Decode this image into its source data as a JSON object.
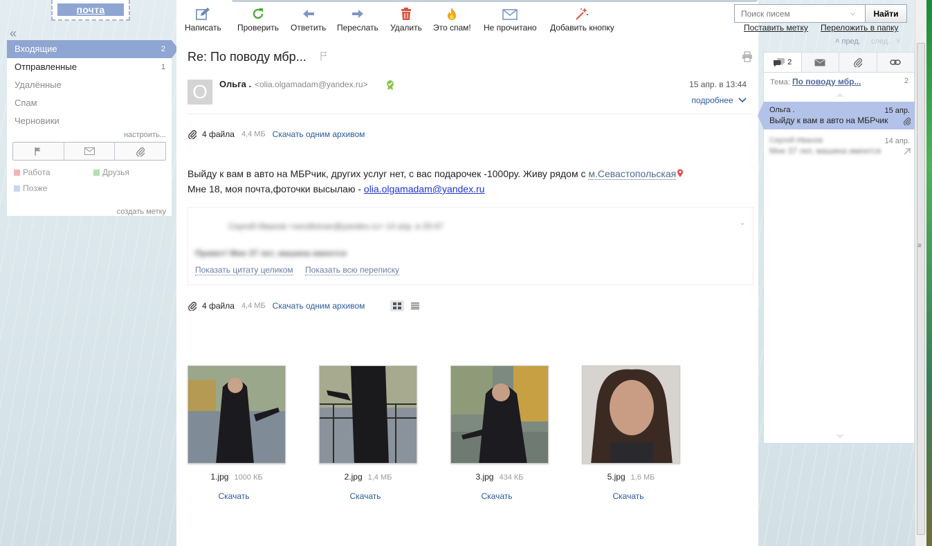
{
  "logo": "почта",
  "sidebar": {
    "collapse_glyph": "«",
    "folders": [
      {
        "label": "Входящие",
        "count": "2"
      },
      {
        "label": "Отправленные",
        "count": "1"
      },
      {
        "label": "Удалённые",
        "count": ""
      },
      {
        "label": "Спам",
        "count": ""
      },
      {
        "label": "Черновики",
        "count": ""
      }
    ],
    "configure": "настроить...",
    "labels": [
      {
        "label": "Работа",
        "color": "#f4b4b4"
      },
      {
        "label": "Друзья",
        "color": "#b2e0b2"
      },
      {
        "label": "Позже",
        "color": "#c8d6f0"
      }
    ],
    "create_label": "создать метку"
  },
  "toolbar": {
    "compose": "Написать",
    "check": "Проверить",
    "reply": "Ответить",
    "forward": "Переслать",
    "delete": "Удалить",
    "spam": "Это спам!",
    "unread": "Не прочитано",
    "add_button": "Добавить кнопку",
    "search_placeholder": "Поиск писем",
    "search_button": "Найти",
    "set_label": "Поставить метку",
    "move_to_folder": "Переложить в папку"
  },
  "message": {
    "subject": "Re: По поводу мбр...",
    "avatar_letter": "О",
    "sender_name": "Ольга .",
    "sender_email": "<olia.olgamadam@yandex.ru>",
    "date": "15 апр. в 13:44",
    "details": "подробнее",
    "attachments_top": {
      "count": "4 файла",
      "size": "4,4 МБ",
      "download_all": "Скачать одним архивом"
    },
    "body_line1": "Выйду к вам в авто на МБРчик, других услуг нет, с вас подарочек -1000ру. Живу рядом с ",
    "metro": "м.Севастопольская",
    "body_line2": "Мне 18, моя почта,фоточки высылаю - ",
    "body_link": "olia.olgamadam@yandex.ru",
    "quote": {
      "header": "Сергей Иванов   <sendtoivan@yandex.ru>   14 апр. в 20:47",
      "text": "Привет! Мне 37 лет, машина имеется",
      "show_full": "Показать цитату целиком",
      "show_thread": "Показать всю переписку"
    },
    "attachments_bottom": {
      "count": "4 файла",
      "size": "4,4 МБ",
      "download_all": "Скачать одним архивом"
    },
    "files": [
      {
        "name": "1.jpg",
        "size": "1000 КБ",
        "download": "Скачать"
      },
      {
        "name": "2.jpg",
        "size": "1,4 МБ",
        "download": "Скачать"
      },
      {
        "name": "3.jpg",
        "size": "434 КБ",
        "download": "Скачать"
      },
      {
        "name": "5.jpg",
        "size": "1,6 МБ",
        "download": "Скачать"
      }
    ]
  },
  "thread": {
    "prev": "пред.",
    "next": "след.",
    "tab_count": "2",
    "theme_label": "Тема:",
    "theme_value": "По поводу мбр...",
    "theme_count": "2",
    "items": [
      {
        "from": "Ольга .",
        "date": "15 апр.",
        "snippet": "Выйду к вам в авто на МБРчик"
      },
      {
        "from": "Сергей Иванов",
        "date": "14 апр.",
        "snippet": "Мне 37 лет, машина имеется"
      }
    ]
  }
}
